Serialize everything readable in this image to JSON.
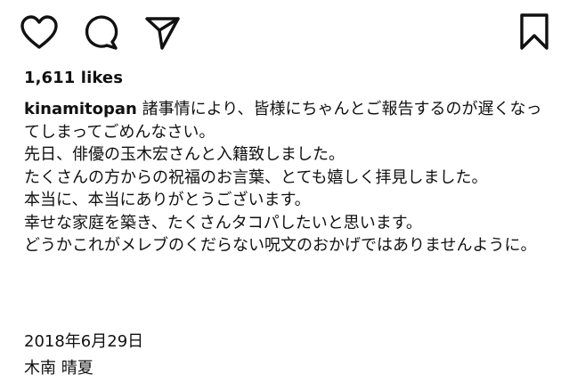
{
  "actions": {
    "like_icon": "heart-outline",
    "comment_icon": "speech-bubble-outline",
    "share_icon": "paper-plane-outline",
    "save_icon": "bookmark-outline"
  },
  "post": {
    "likes": "1,611 likes",
    "username": "kinamitopan",
    "caption_first": " 諸事情により、皆様にちゃんとご報告するのが遅くなってしまってごめんなさい。",
    "caption_lines": [
      "先日、俳優の玉木宏さんと入籍致しました。",
      "たくさんの方からの祝福のお言葉、とても嬉しく拝見しました。",
      "本当に、本当にありがとうございます。",
      "幸せな家庭を築き、たくさんタコパしたいと思います。",
      "どうかこれがメレブのくだらない呪文のおかげではありませんように。"
    ],
    "date": "2018年6月29日",
    "signature": "木南 晴夏"
  }
}
